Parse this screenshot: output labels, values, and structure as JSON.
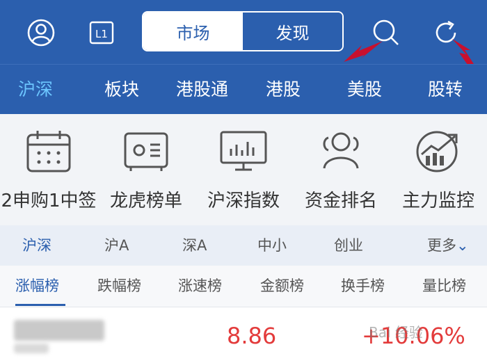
{
  "segment": {
    "market": "市场",
    "discover": "发现"
  },
  "nav_tabs": [
    "沪深",
    "板块",
    "港股通",
    "港股",
    "美股",
    "股转"
  ],
  "level_badge": "L1",
  "quick_links": [
    "2申购1中签",
    "龙虎榜单",
    "沪深指数",
    "资金排名",
    "主力监控"
  ],
  "market_tabs": [
    "沪深",
    "沪A",
    "深A",
    "中小",
    "创业"
  ],
  "more_label": "更多",
  "rank_tabs": [
    "涨幅榜",
    "跌幅榜",
    "涨速榜",
    "金额榜",
    "换手榜",
    "量比榜"
  ],
  "stock_row": {
    "price": "8.86",
    "change": "+10.06%"
  },
  "watermark": "Bai 经验",
  "colors": {
    "header": "#2b5fae",
    "active_tab": "#6cc6ff",
    "up": "#e33b3b",
    "arrow": "#c8102e"
  }
}
